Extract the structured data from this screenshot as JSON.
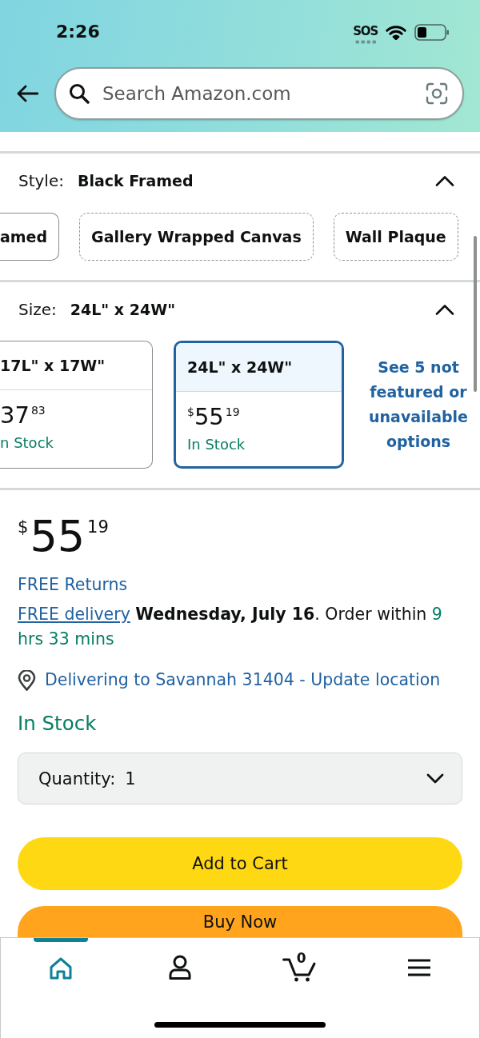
{
  "status_bar": {
    "time": "2:26",
    "sos": "SOS"
  },
  "search": {
    "placeholder": "Search Amazon.com"
  },
  "style": {
    "label": "Style:",
    "value": "Black Framed",
    "expanded": true,
    "options": [
      {
        "label": "amed",
        "available": true,
        "selected": false
      },
      {
        "label": "Gallery Wrapped Canvas",
        "available": false,
        "selected": false
      },
      {
        "label": "Wall Plaque",
        "available": false,
        "selected": false
      }
    ]
  },
  "size": {
    "label": "Size:",
    "value": "24L\" x 24W\"",
    "expanded": true,
    "options": [
      {
        "name": "17L\" x 17W\"",
        "whole": "37",
        "fraction": "83",
        "stock": "n Stock",
        "selected": false
      },
      {
        "name": "24L\" x 24W\"",
        "currency": "$",
        "whole": "55",
        "fraction": "19",
        "stock": "In Stock",
        "selected": true
      }
    ],
    "more_link": "See 5 not featured or unavailable options"
  },
  "price": {
    "currency": "$",
    "whole": "55",
    "fraction": "19"
  },
  "returns_link": "FREE Returns",
  "delivery": {
    "link": "FREE delivery",
    "text": "**Wednesday, July 16**. Order within",
    "countdown": "9 hrs 33 mins"
  },
  "location": "Delivering to Savannah 31404 - Update location",
  "availability": "In Stock",
  "quantity": {
    "label": "Quantity:",
    "value": "1"
  },
  "buttons": [
    {
      "kind": "cart",
      "label": "Add to Cart"
    },
    {
      "kind": "buy",
      "label": "Buy Now"
    }
  ],
  "bottom_nav": [
    {
      "kind": "home",
      "selected": true
    },
    {
      "kind": "account",
      "selected": false
    },
    {
      "kind": "cart",
      "selected": false,
      "count": "0"
    },
    {
      "kind": "menu",
      "selected": false
    }
  ]
}
